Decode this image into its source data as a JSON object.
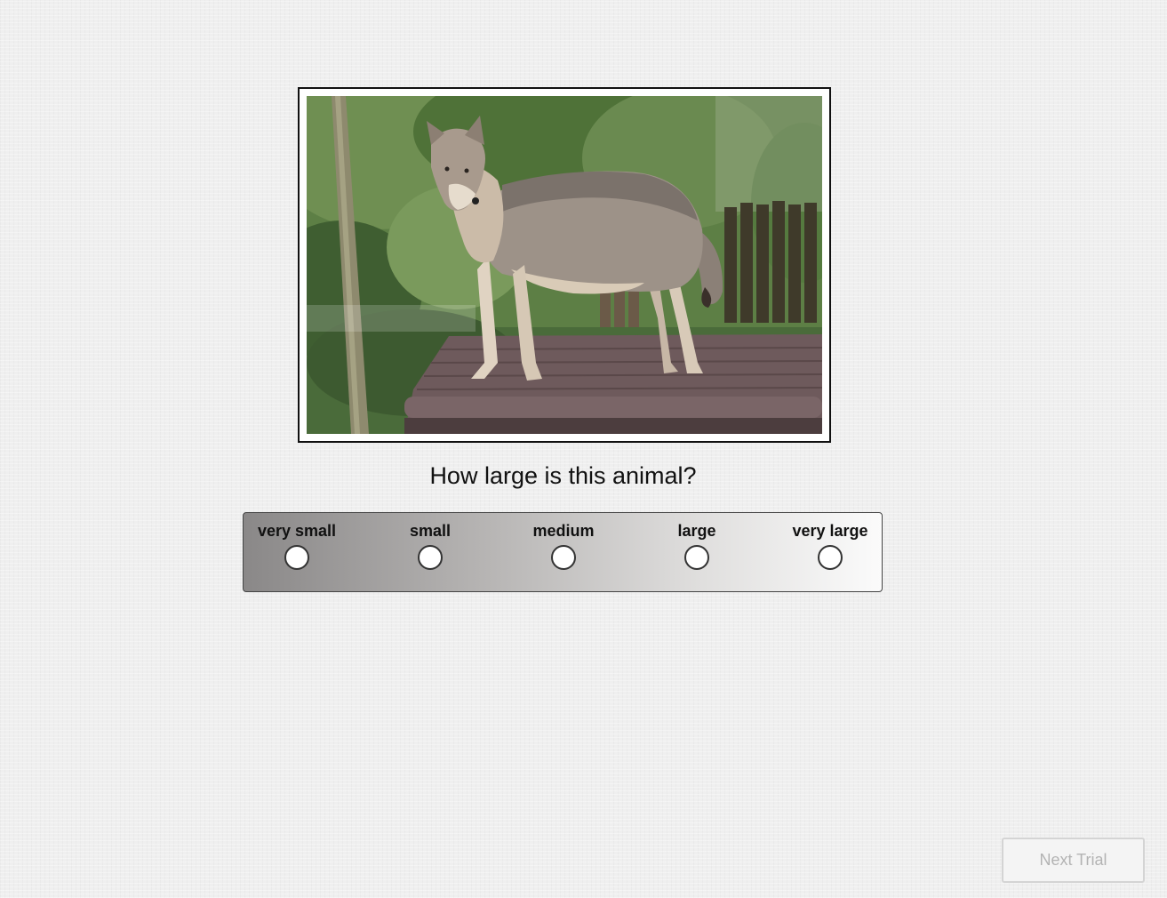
{
  "question": "How large is this animal?",
  "scale": {
    "options": [
      {
        "label": "very small"
      },
      {
        "label": "small"
      },
      {
        "label": "medium"
      },
      {
        "label": "large"
      },
      {
        "label": "very large"
      }
    ]
  },
  "next_button": {
    "label": "Next Trial",
    "disabled": true
  },
  "stimulus": {
    "subject": "wolf standing on wooden platform"
  }
}
